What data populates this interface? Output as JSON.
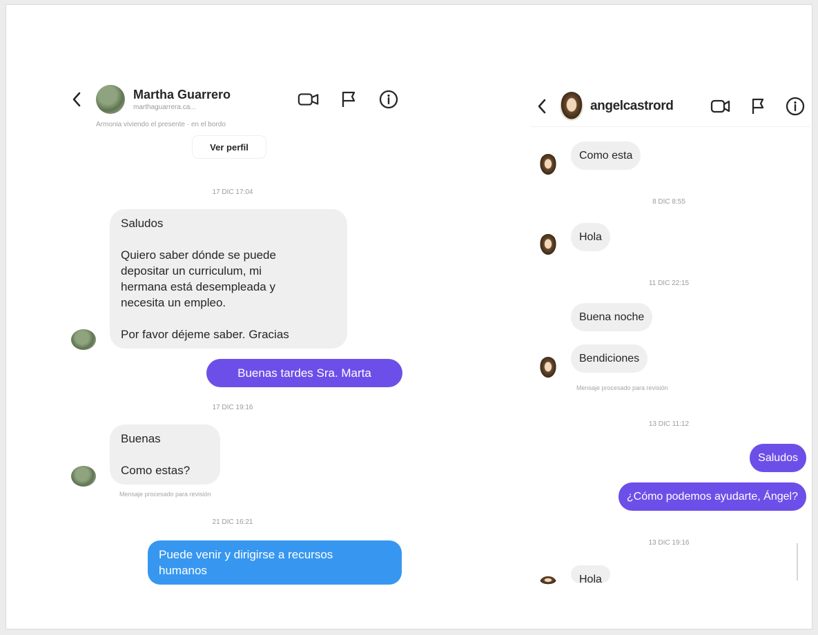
{
  "left_chat": {
    "name": "Martha Guarrero",
    "handle": "marthaguarrera.ca.​..",
    "caption": "Armonia viviendo el presente · en el bordo",
    "profile_button": "Ver perfil",
    "timestamps": [
      "17 DIC 17:04",
      "17 DIC 19:16",
      "21 DIC 16:21"
    ],
    "msg1_lines": [
      "Saludos",
      "",
      "Quiero saber dónde se puede",
      "depositar un curriculum, mi",
      "hermana está desempleada y",
      "necesita un empleo.",
      "",
      "Por favor déjeme saber. Gracias"
    ],
    "reply1": "Buenas tardes Sra. Marta",
    "msg2_lines": [
      "Buenas",
      "",
      "Como estas?"
    ],
    "seen_note": "Mensaje procesado para revisión",
    "reply2_lines": [
      "Puede venir y dirigirse a recursos",
      "humanos"
    ]
  },
  "right_chat": {
    "name": "angelcastrord",
    "messages": {
      "m1": "Como esta",
      "ts1": "8 DIC 8:55",
      "m2": "Hola",
      "ts2": "11 DIC 22:15",
      "m3": "Buena noche",
      "m4": "Bendiciones",
      "note": "Mensaje procesado para revisión",
      "ts3": "13 DIC 11:12",
      "r1": "Saludos",
      "r2": "¿Cómo podemos ayudarte, Ángel?",
      "ts4": "13 DIC 19:16",
      "m5": "Hola"
    }
  },
  "icons": [
    "back-icon",
    "video-camera-icon",
    "flag-icon",
    "info-icon"
  ],
  "colors": {
    "outgoing": "#6c4fe8",
    "outgoing_alt": "#3797f0",
    "incoming": "#efefef"
  }
}
